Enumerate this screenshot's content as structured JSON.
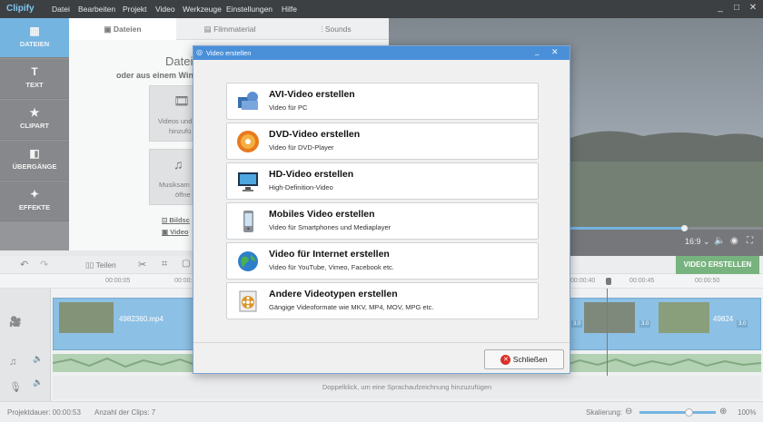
{
  "app": {
    "logo": "Clipify"
  },
  "menu": [
    "Datei",
    "Bearbeiten",
    "Projekt",
    "Video",
    "Werkzeuge",
    "Einstellungen",
    "Hilfe"
  ],
  "window_controls": {
    "minimize": "_",
    "maximize": "□",
    "close": "✕"
  },
  "nav": [
    {
      "label": "DATEIEN",
      "icon": "files-icon"
    },
    {
      "label": "TEXT",
      "icon": "text-icon"
    },
    {
      "label": "CLIPART",
      "icon": "star-icon"
    },
    {
      "label": "ÜBERGÄNGE",
      "icon": "transition-icon"
    },
    {
      "label": "EFFEKTE",
      "icon": "magic-wand-icon"
    }
  ],
  "tabs": [
    {
      "label": "Dateien",
      "icon": "folder-icon"
    },
    {
      "label": "Filmmaterial",
      "icon": "film-icon"
    },
    {
      "label": "Sounds",
      "icon": "sound-wave-icon"
    }
  ],
  "files": {
    "heading": "Datei",
    "subheading": "oder aus einem Wind",
    "tile1": [
      "Videos und",
      "hinzufü"
    ],
    "tile2": [
      "Musiksam",
      "öffne"
    ],
    "link1": "Bildsc",
    "link2": "Video"
  },
  "preview": {
    "aspect": "16:9 ⌄",
    "create_button": "VIDEO ERSTELLEN"
  },
  "toolbar": {
    "split": "Teilen"
  },
  "ruler": [
    "00:00:05",
    "00:00:10",
    "00:00:40",
    "00:00:45",
    "00:00:50"
  ],
  "timeline": {
    "clip1": "4982360.mp4",
    "clip2": "49824",
    "badges": [
      "3.0",
      "3.0",
      "3.0"
    ],
    "voice_hint": "Doppelklick, um eine Sprachaufzeichnung hinzuzufügen"
  },
  "status": {
    "duration": "Projektdauer:  00:00:53",
    "clips": "Anzahl der Clips: 7",
    "scale_label": "Skalierung:",
    "zoom": "100%"
  },
  "dialog": {
    "title": "Video erstellen",
    "options": [
      {
        "title": "AVI-Video erstellen",
        "sub": "Video für PC",
        "icon": "avi-video-icon"
      },
      {
        "title": "DVD-Video erstellen",
        "sub": "Video für DVD-Player",
        "icon": "dvd-disc-icon"
      },
      {
        "title": "HD-Video erstellen",
        "sub": "High-Definition-Video",
        "icon": "hd-monitor-icon"
      },
      {
        "title": "Mobiles Video erstellen",
        "sub": "Video für Smartphones und Mediaplayer",
        "icon": "mobile-phone-icon"
      },
      {
        "title": "Video für Internet erstellen",
        "sub": "Video für YouTube, Vimeo, Facebook etc.",
        "icon": "globe-icon"
      },
      {
        "title": "Andere Videotypen erstellen",
        "sub": "Gängige Videoformate wie MKV, MP4, MOV, MPG etc.",
        "icon": "film-reel-icon"
      }
    ],
    "close": "Schließen"
  },
  "colors": {
    "accent": "#2a8ccf",
    "create_green": "#2e8b3a",
    "dialog_title": "#4a90d9"
  }
}
